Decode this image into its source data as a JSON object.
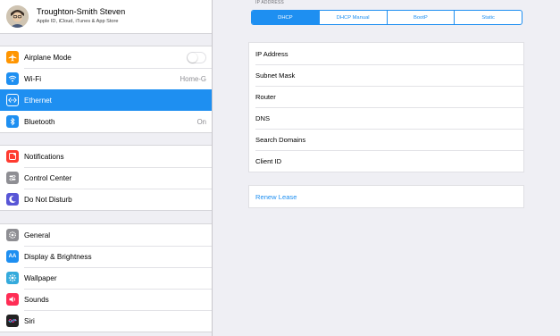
{
  "profile": {
    "name": "Troughton-Smith Steven",
    "subtitle": "Apple ID, iCloud, iTunes & App Store"
  },
  "sidebar": {
    "group1": [
      {
        "label": "Airplane Mode",
        "icon": "airplane-icon",
        "color": "#ff9500",
        "control": "toggle",
        "toggle_on": false
      },
      {
        "label": "Wi-Fi",
        "icon": "wifi-icon",
        "color": "#1e8ff1",
        "value": "Home-G"
      },
      {
        "label": "Ethernet",
        "icon": "ethernet-icon",
        "color": "#1e8ff1",
        "selected": true
      },
      {
        "label": "Bluetooth",
        "icon": "bluetooth-icon",
        "color": "#1e8ff1",
        "value": "On"
      }
    ],
    "group2": [
      {
        "label": "Notifications",
        "icon": "notifications-icon",
        "color": "#ff3b30"
      },
      {
        "label": "Control Center",
        "icon": "control-center-icon",
        "color": "#8e8e93"
      },
      {
        "label": "Do Not Disturb",
        "icon": "moon-icon",
        "color": "#5856d6"
      }
    ],
    "group3": [
      {
        "label": "General",
        "icon": "gear-icon",
        "color": "#8e8e93"
      },
      {
        "label": "Display & Brightness",
        "icon": "display-icon",
        "color": "#1e8ff1"
      },
      {
        "label": "Wallpaper",
        "icon": "wallpaper-icon",
        "color": "#34aadc"
      },
      {
        "label": "Sounds",
        "icon": "sounds-icon",
        "color": "#ff2d55"
      },
      {
        "label": "Siri",
        "icon": "siri-icon",
        "color": "#222222"
      }
    ]
  },
  "detail": {
    "section_header": "IP ADDRESS",
    "segments": [
      {
        "label": "DHCP",
        "active": true
      },
      {
        "label": "DHCP Manual",
        "active": false
      },
      {
        "label": "BootP",
        "active": false
      },
      {
        "label": "Static",
        "active": false
      }
    ],
    "fields": [
      "IP Address",
      "Subnet Mask",
      "Router",
      "DNS",
      "Search Domains",
      "Client ID"
    ],
    "renew_label": "Renew Lease"
  }
}
